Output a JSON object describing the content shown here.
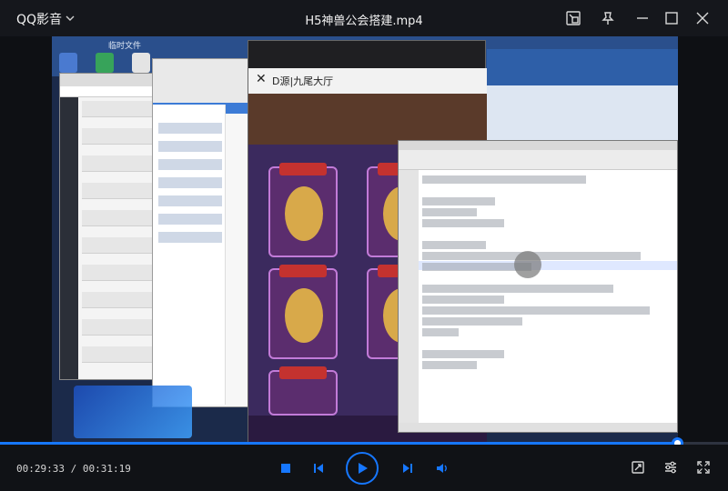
{
  "app": {
    "brand": "QQ影音",
    "file_title": "H5神兽公会搭建.mp4"
  },
  "video": {
    "desktop_label": "临时文件",
    "phone_title": "D源|九尾大厅"
  },
  "player": {
    "progress_fraction": 0.9303,
    "elapsed": "00:29:33",
    "total": "00:31:19"
  },
  "colors": {
    "accent": "#1677ff",
    "background": "#101216"
  },
  "icons": {
    "brand_menu": "chevron-down-icon",
    "picture": "picture-in-picture-icon",
    "pin": "pin-icon",
    "minimize": "minimize-icon",
    "maximize": "maximize-icon",
    "close": "close-icon",
    "stop": "stop-icon",
    "prev": "previous-icon",
    "play": "play-icon",
    "next": "next-icon",
    "volume": "volume-icon",
    "screenshot": "screenshot-icon",
    "settings": "settings-icon",
    "fullscreen": "fullscreen-icon"
  }
}
